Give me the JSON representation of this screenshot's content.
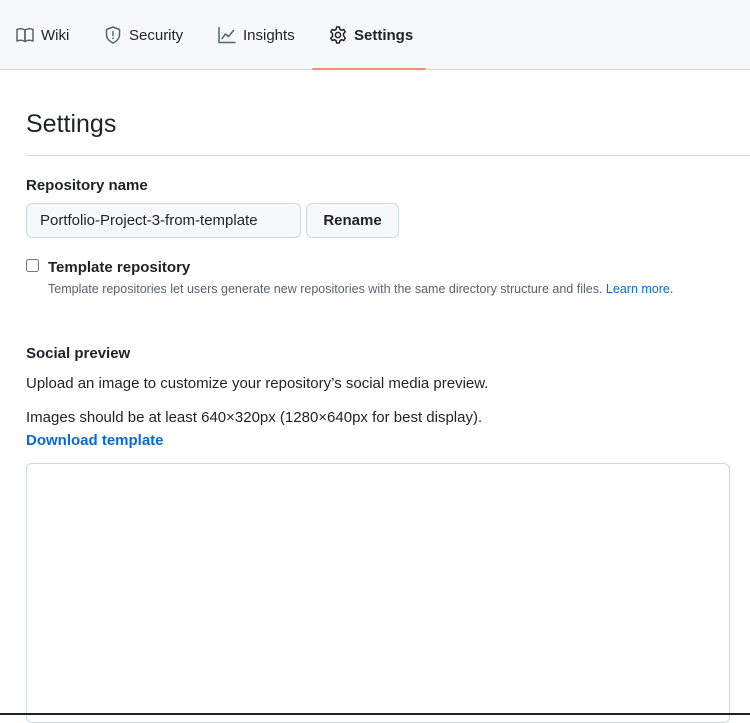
{
  "tabs": [
    {
      "label": "Wiki",
      "icon": "book-icon",
      "selected": false
    },
    {
      "label": "Security",
      "icon": "shield-icon",
      "selected": false
    },
    {
      "label": "Insights",
      "icon": "graph-icon",
      "selected": false
    },
    {
      "label": "Settings",
      "icon": "gear-icon",
      "selected": true
    }
  ],
  "page": {
    "title": "Settings"
  },
  "repository": {
    "label": "Repository name",
    "value": "Portfolio-Project-3-from-template",
    "rename_label": "Rename"
  },
  "template_repo": {
    "label": "Template repository",
    "checked": false,
    "description": "Template repositories let users generate new repositories with the same directory structure and files.",
    "learn_more": "Learn more."
  },
  "social_preview": {
    "heading": "Social preview",
    "description": "Upload an image to customize your repository’s social media preview.",
    "size_note": "Images should be at least 640×320px (1280×640px for best display).",
    "download_label": "Download template"
  },
  "colors": {
    "accent_underline": "#fd8c73",
    "link": "#0969da",
    "border": "#d0d7de",
    "tabbar_bg": "#f6f8fa"
  }
}
